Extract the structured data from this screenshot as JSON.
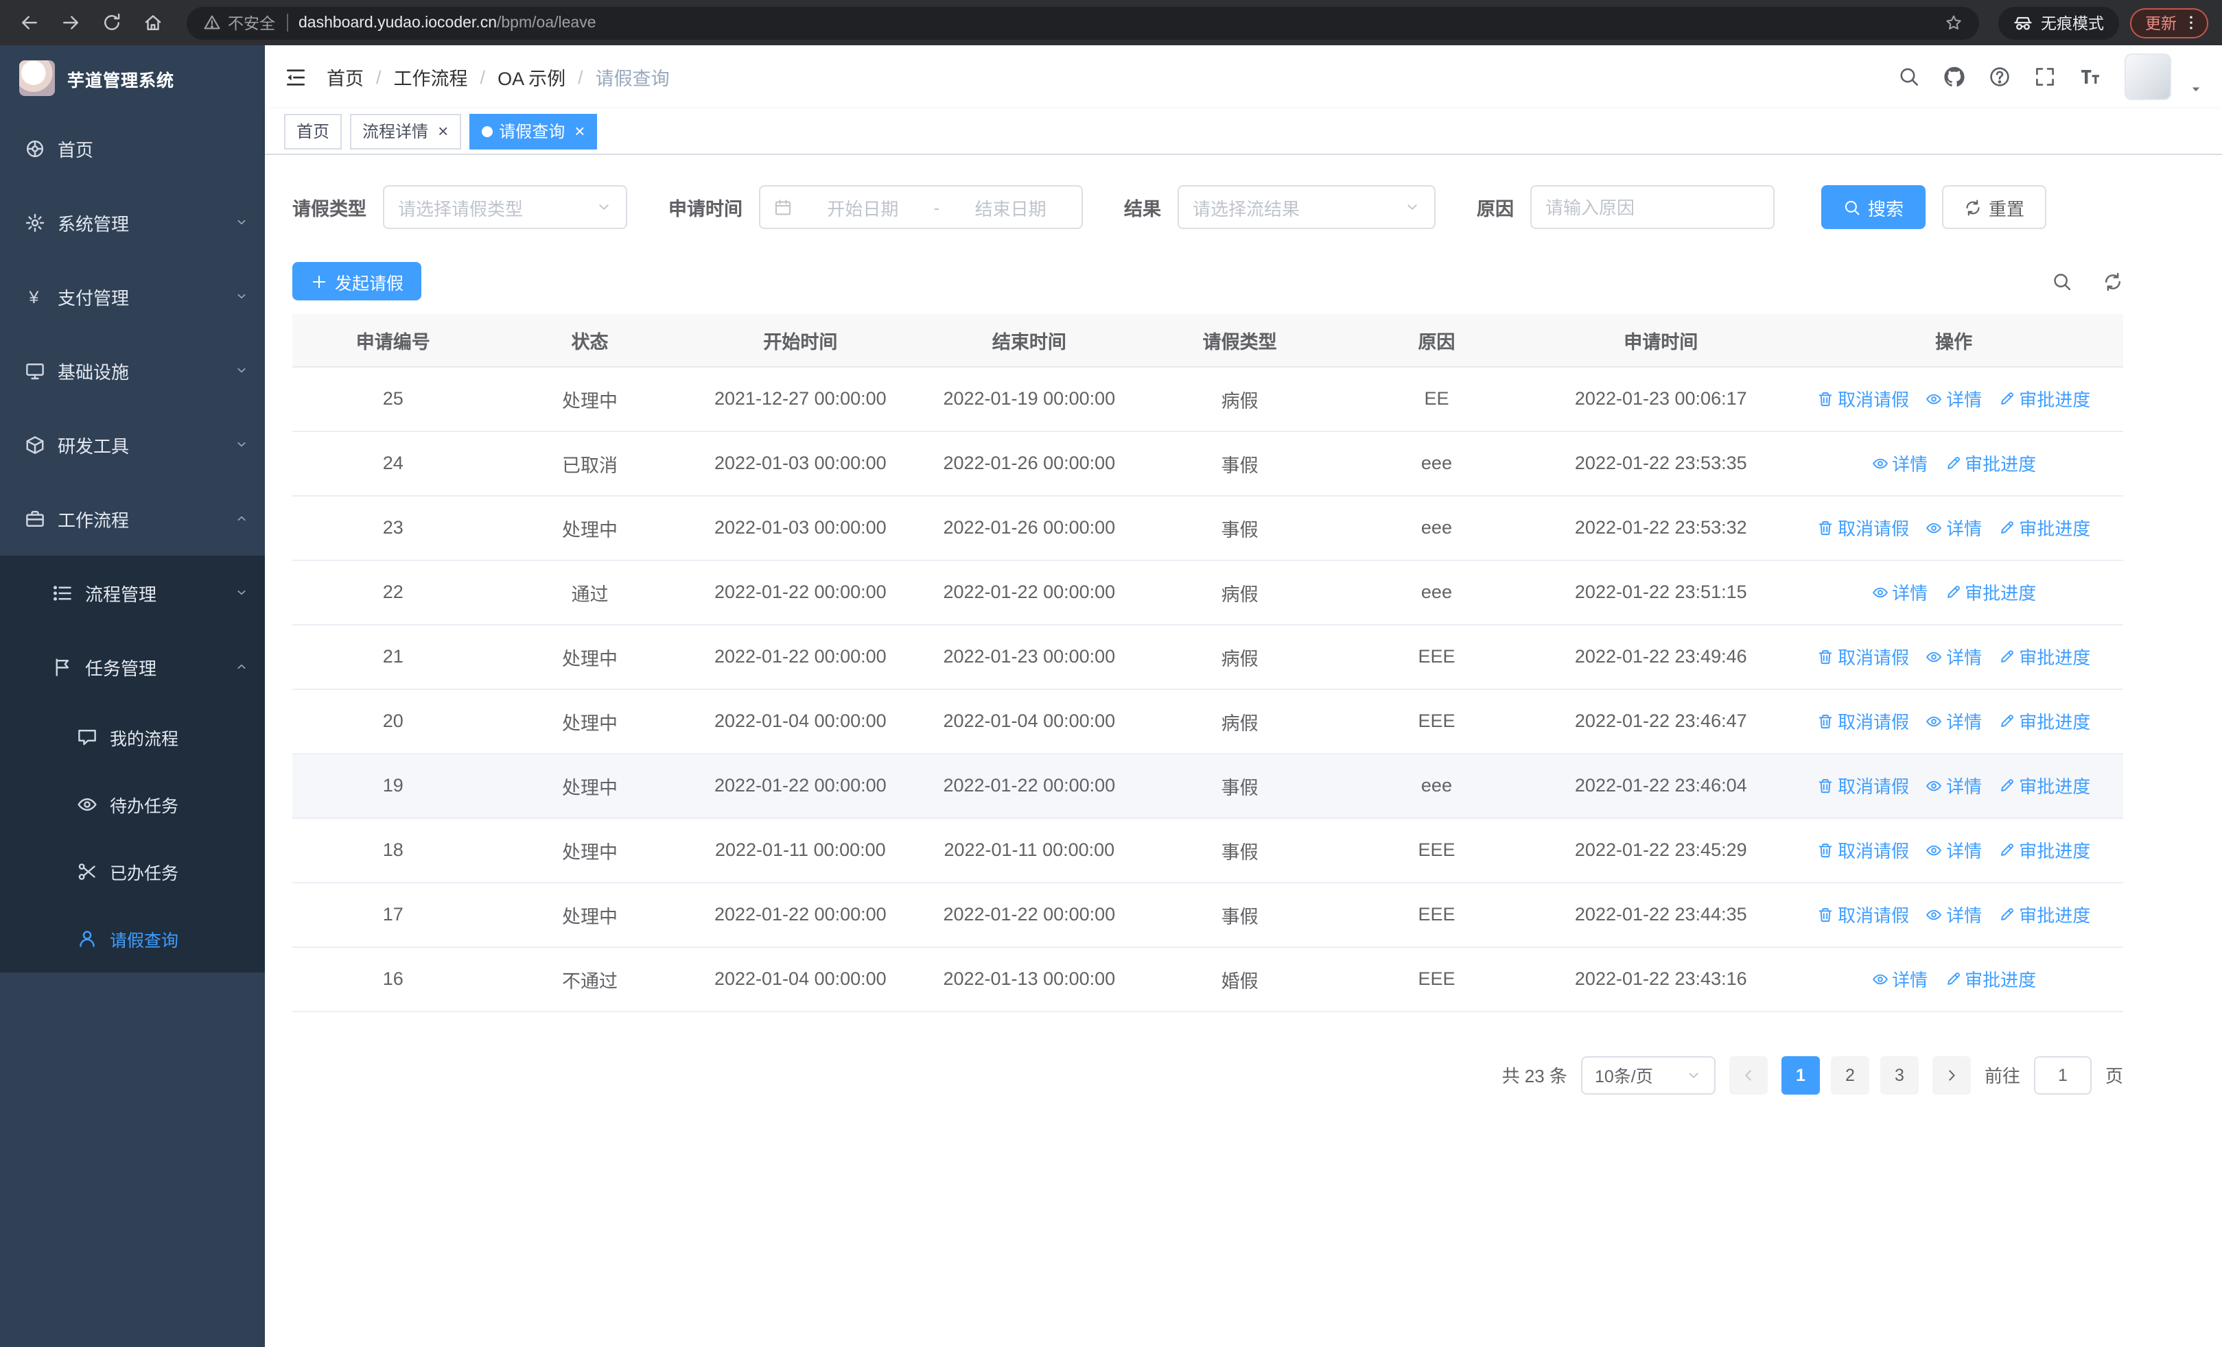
{
  "browser": {
    "security_label": "不安全",
    "url_host": "dashboard.yudao.iocoder.cn",
    "url_path": "/bpm/oa/leave",
    "incognito_label": "无痕模式",
    "update_label": "更新"
  },
  "sidebar": {
    "logo_title": "芋道管理系统",
    "items": [
      {
        "key": "home",
        "label": "首页",
        "icon": "wheel",
        "level": 1
      },
      {
        "key": "system",
        "label": "系统管理",
        "icon": "gear",
        "level": 1,
        "chevron": "down"
      },
      {
        "key": "payment",
        "label": "支付管理",
        "icon": "yen",
        "level": 1,
        "chevron": "down"
      },
      {
        "key": "infra",
        "label": "基础设施",
        "icon": "monitor",
        "level": 1,
        "chevron": "down"
      },
      {
        "key": "devtools",
        "label": "研发工具",
        "icon": "box",
        "level": 1,
        "chevron": "down"
      },
      {
        "key": "workflow",
        "label": "工作流程",
        "icon": "briefcase",
        "level": 1,
        "chevron": "up",
        "open": true
      },
      {
        "key": "process-mgmt",
        "label": "流程管理",
        "icon": "list",
        "level": 2,
        "chevron": "down"
      },
      {
        "key": "task-mgmt",
        "label": "任务管理",
        "icon": "flag",
        "level": 2,
        "chevron": "up",
        "open": true
      },
      {
        "key": "my-process",
        "label": "我的流程",
        "icon": "chat",
        "level": 3
      },
      {
        "key": "todo-tasks",
        "label": "待办任务",
        "icon": "eye",
        "level": 3
      },
      {
        "key": "done-tasks",
        "label": "已办任务",
        "icon": "scissors",
        "level": 3
      },
      {
        "key": "leave-query",
        "label": "请假查询",
        "icon": "user",
        "level": 3,
        "active": true
      }
    ]
  },
  "header": {
    "breadcrumb": [
      {
        "label": "首页"
      },
      {
        "label": "工作流程"
      },
      {
        "label": "OA 示例"
      },
      {
        "label": "请假查询",
        "current": true
      }
    ]
  },
  "tabs": [
    {
      "key": "home",
      "label": "首页",
      "closable": false,
      "active": false
    },
    {
      "key": "process-detail",
      "label": "流程详情",
      "closable": true,
      "active": false
    },
    {
      "key": "leave-query",
      "label": "请假查询",
      "closable": true,
      "active": true
    }
  ],
  "filters": {
    "leave_type_label": "请假类型",
    "leave_type_placeholder": "请选择请假类型",
    "apply_time_label": "申请时间",
    "date_start_placeholder": "开始日期",
    "date_separator": "-",
    "date_end_placeholder": "结束日期",
    "result_label": "结果",
    "result_placeholder": "请选择流结果",
    "reason_label": "原因",
    "reason_placeholder": "请输入原因",
    "search_label": "搜索",
    "reset_label": "重置"
  },
  "toolbar": {
    "create_label": "发起请假"
  },
  "table": {
    "columns": [
      "申请编号",
      "状态",
      "开始时间",
      "结束时间",
      "请假类型",
      "原因",
      "申请时间",
      "操作"
    ],
    "action_labels": {
      "cancel": "取消请假",
      "detail": "详情",
      "progress": "审批进度"
    },
    "rows": [
      {
        "id": "25",
        "status": "处理中",
        "start": "2021-12-27 00:00:00",
        "end": "2022-01-19 00:00:00",
        "type": "病假",
        "reason": "EE",
        "applied": "2022-01-23 00:06:17",
        "actions": [
          "cancel",
          "detail",
          "progress"
        ]
      },
      {
        "id": "24",
        "status": "已取消",
        "start": "2022-01-03 00:00:00",
        "end": "2022-01-26 00:00:00",
        "type": "事假",
        "reason": "eee",
        "applied": "2022-01-22 23:53:35",
        "actions": [
          "detail",
          "progress"
        ]
      },
      {
        "id": "23",
        "status": "处理中",
        "start": "2022-01-03 00:00:00",
        "end": "2022-01-26 00:00:00",
        "type": "事假",
        "reason": "eee",
        "applied": "2022-01-22 23:53:32",
        "actions": [
          "cancel",
          "detail",
          "progress"
        ]
      },
      {
        "id": "22",
        "status": "通过",
        "start": "2022-01-22 00:00:00",
        "end": "2022-01-22 00:00:00",
        "type": "病假",
        "reason": "eee",
        "applied": "2022-01-22 23:51:15",
        "actions": [
          "detail",
          "progress"
        ]
      },
      {
        "id": "21",
        "status": "处理中",
        "start": "2022-01-22 00:00:00",
        "end": "2022-01-23 00:00:00",
        "type": "病假",
        "reason": "EEE",
        "applied": "2022-01-22 23:49:46",
        "actions": [
          "cancel",
          "detail",
          "progress"
        ]
      },
      {
        "id": "20",
        "status": "处理中",
        "start": "2022-01-04 00:00:00",
        "end": "2022-01-04 00:00:00",
        "type": "病假",
        "reason": "EEE",
        "applied": "2022-01-22 23:46:47",
        "actions": [
          "cancel",
          "detail",
          "progress"
        ]
      },
      {
        "id": "19",
        "status": "处理中",
        "start": "2022-01-22 00:00:00",
        "end": "2022-01-22 00:00:00",
        "type": "事假",
        "reason": "eee",
        "applied": "2022-01-22 23:46:04",
        "actions": [
          "cancel",
          "detail",
          "progress"
        ],
        "highlight": true
      },
      {
        "id": "18",
        "status": "处理中",
        "start": "2022-01-11 00:00:00",
        "end": "2022-01-11 00:00:00",
        "type": "事假",
        "reason": "EEE",
        "applied": "2022-01-22 23:45:29",
        "actions": [
          "cancel",
          "detail",
          "progress"
        ]
      },
      {
        "id": "17",
        "status": "处理中",
        "start": "2022-01-22 00:00:00",
        "end": "2022-01-22 00:00:00",
        "type": "事假",
        "reason": "EEE",
        "applied": "2022-01-22 23:44:35",
        "actions": [
          "cancel",
          "detail",
          "progress"
        ]
      },
      {
        "id": "16",
        "status": "不通过",
        "start": "2022-01-04 00:00:00",
        "end": "2022-01-13 00:00:00",
        "type": "婚假",
        "reason": "EEE",
        "applied": "2022-01-22 23:43:16",
        "actions": [
          "detail",
          "progress"
        ]
      }
    ]
  },
  "pagination": {
    "total_label": "共 23 条",
    "page_size_label": "10条/页",
    "pages": [
      "1",
      "2",
      "3"
    ],
    "active_page": "1",
    "goto_label": "前往",
    "goto_value": "1",
    "goto_suffix": "页"
  },
  "colors": {
    "accent": "#409eff",
    "sidebar_bg": "#304156",
    "submenu_bg": "#1f2d3d",
    "header_bg": "#f8f8f9"
  }
}
